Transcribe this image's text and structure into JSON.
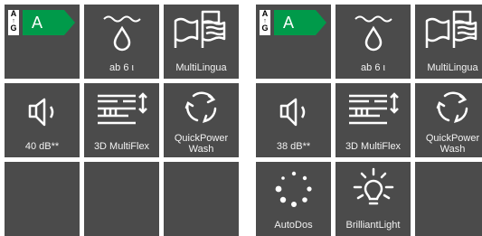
{
  "panels": [
    {
      "energy": {
        "grade": "A",
        "scale_top": "A",
        "scale_bottom": "G",
        "color": "#009a4a"
      },
      "tiles": [
        {
          "label": "ab 6 ι"
        },
        {
          "label": "MultiLingua"
        },
        {
          "label": "40 dB**"
        },
        {
          "label": "3D MultiFlex"
        },
        {
          "label": "QuickPower Wash",
          "line1": "QuickPower",
          "line2": "Wash"
        },
        {
          "label": ""
        },
        {
          "label": ""
        },
        {
          "label": ""
        }
      ]
    },
    {
      "energy": {
        "grade": "A",
        "scale_top": "A",
        "scale_bottom": "G",
        "color": "#009a4a"
      },
      "tiles": [
        {
          "label": "ab 6 ι"
        },
        {
          "label": "MultiLingua"
        },
        {
          "label": "38 dB**"
        },
        {
          "label": "3D MultiFlex"
        },
        {
          "label": "QuickPower Wash",
          "line1": "QuickPower",
          "line2": "Wash"
        },
        {
          "label": "AutoDos"
        },
        {
          "label": "BrilliantLight"
        },
        {
          "label": ""
        }
      ]
    }
  ],
  "icons": {
    "energy": "energy-label-icon",
    "water": "water-drop-icon",
    "flags": "flags-icon",
    "speaker": "speaker-icon",
    "basket": "basket-adjust-icon",
    "cycle": "quick-wash-cycle-icon",
    "dots": "autodos-dots-icon",
    "light": "brilliant-light-icon"
  },
  "colors": {
    "tile_bg": "#4b4b4b",
    "text": "#ffffff",
    "energy_green": "#009a4a"
  }
}
